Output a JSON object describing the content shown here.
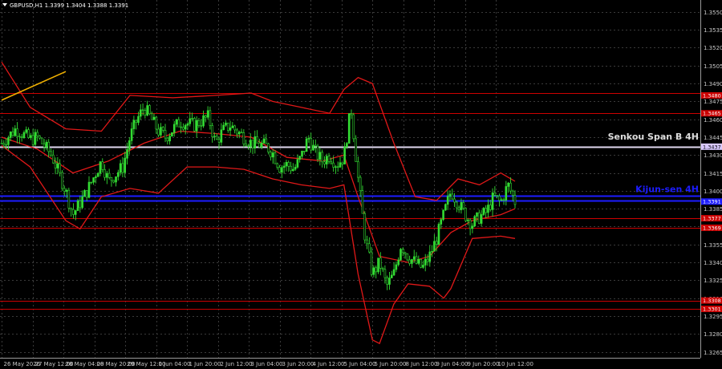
{
  "chart_data": {
    "type": "candlestick",
    "symbol_header": "GBPUSD,H1  1.3399 1.3404 1.3388 1.3391",
    "ylim": [
      1.326,
      1.356
    ],
    "y_ticks": [
      "1.3550",
      "1.3535",
      "1.3520",
      "1.3505",
      "1.3490",
      "1.3475",
      "1.3460",
      "1.3445",
      "1.3430",
      "1.3415",
      "1.3400",
      "1.3385",
      "1.3370",
      "1.3355",
      "1.3340",
      "1.3325",
      "1.3310",
      "1.3295",
      "1.3280",
      "1.3265"
    ],
    "x_labels": [
      "26 May 2026",
      "27 May 12:00",
      "28 May 04:00",
      "28 May 20:00",
      "29 May 12:00",
      "1 Jun 04:00",
      "1 Jun 20:00",
      "2 Jun 12:00",
      "3 Jun 04:00",
      "3 Jun 20:00",
      "4 Jun 12:00",
      "5 Jun 04:00",
      "5 Jun 20:00",
      "8 Jun 12:00",
      "9 Jun 04:00",
      "9 Jun 20:00",
      "10 Jun 12:00"
    ],
    "price_levels": [
      {
        "value": "1.3480",
        "color": "#cc0000"
      },
      {
        "value": "1.3465",
        "color": "#cc0000"
      },
      {
        "value": "1.3437",
        "color": "#d8c8ff"
      },
      {
        "value": "1.3391",
        "color": "#1c1cff"
      },
      {
        "value": "1.3377",
        "color": "#cc0000"
      },
      {
        "value": "1.3369",
        "color": "#cc0000"
      },
      {
        "value": "1.3308",
        "color": "#cc0000"
      },
      {
        "value": "1.3301",
        "color": "#cc0000"
      }
    ],
    "level_lines": [
      1.3482,
      1.3465,
      1.3437,
      1.3396,
      1.3392,
      1.3377,
      1.3369,
      1.3308,
      1.3301
    ],
    "annotations": [
      {
        "text": "Senkou Span B 4H",
        "value": 1.3443,
        "color": "#dcdcdc"
      },
      {
        "text": "Kijun-sen 4H",
        "value": 1.3399,
        "color": "#1c1cff"
      }
    ],
    "close_path": [
      [
        0,
        1.344
      ],
      [
        2,
        1.3452
      ],
      [
        4,
        1.3443
      ],
      [
        5,
        1.3445
      ],
      [
        7,
        1.343
      ],
      [
        9,
        1.34
      ],
      [
        10,
        1.338
      ],
      [
        11,
        1.339
      ],
      [
        12,
        1.34
      ],
      [
        14,
        1.3425
      ],
      [
        15,
        1.3408
      ],
      [
        17,
        1.342
      ],
      [
        18,
        1.3445
      ],
      [
        19,
        1.346
      ],
      [
        20,
        1.347
      ],
      [
        22,
        1.345
      ],
      [
        23,
        1.3445
      ],
      [
        25,
        1.3458
      ],
      [
        27,
        1.3455
      ],
      [
        29,
        1.3462
      ],
      [
        30,
        1.344
      ],
      [
        31,
        1.345
      ],
      [
        32,
        1.3455
      ],
      [
        34,
        1.3445
      ],
      [
        35,
        1.344
      ],
      [
        37,
        1.3438
      ],
      [
        38,
        1.3432
      ],
      [
        39,
        1.342
      ],
      [
        40,
        1.3422
      ],
      [
        41,
        1.3418
      ],
      [
        42,
        1.3428
      ],
      [
        43,
        1.3445
      ],
      [
        44,
        1.3432
      ],
      [
        45,
        1.3425
      ],
      [
        46,
        1.343
      ],
      [
        47,
        1.3422
      ],
      [
        48,
        1.3428
      ],
      [
        49,
        1.347
      ],
      [
        50,
        1.341
      ],
      [
        51,
        1.336
      ],
      [
        52,
        1.333
      ],
      [
        53,
        1.334
      ],
      [
        54,
        1.332
      ],
      [
        55,
        1.333
      ],
      [
        56,
        1.3355
      ],
      [
        57,
        1.3345
      ],
      [
        58,
        1.334
      ],
      [
        59,
        1.3335
      ],
      [
        60,
        1.3345
      ],
      [
        61,
        1.336
      ],
      [
        62,
        1.338
      ],
      [
        63,
        1.34
      ],
      [
        64,
        1.339
      ],
      [
        65,
        1.338
      ],
      [
        66,
        1.3372
      ],
      [
        67,
        1.3378
      ],
      [
        68,
        1.3382
      ],
      [
        69,
        1.3395
      ],
      [
        70,
        1.339
      ],
      [
        71,
        1.3405
      ],
      [
        72,
        1.3391
      ]
    ],
    "indicator_upper": [
      [
        0,
        1.3508
      ],
      [
        4,
        1.347
      ],
      [
        9,
        1.3452
      ],
      [
        14,
        1.345
      ],
      [
        18,
        1.348
      ],
      [
        24,
        1.3478
      ],
      [
        30,
        1.348
      ],
      [
        35,
        1.3482
      ],
      [
        38,
        1.3475
      ],
      [
        42,
        1.347
      ],
      [
        46,
        1.3465
      ],
      [
        48,
        1.3485
      ],
      [
        50,
        1.3495
      ],
      [
        52,
        1.349
      ],
      [
        55,
        1.344
      ],
      [
        58,
        1.3395
      ],
      [
        61,
        1.3392
      ],
      [
        64,
        1.341
      ],
      [
        67,
        1.3405
      ],
      [
        70,
        1.3415
      ],
      [
        72,
        1.3408
      ]
    ],
    "indicator_lower": [
      [
        0,
        1.3438
      ],
      [
        4,
        1.342
      ],
      [
        9,
        1.3375
      ],
      [
        11,
        1.3368
      ],
      [
        14,
        1.3395
      ],
      [
        18,
        1.3402
      ],
      [
        22,
        1.3398
      ],
      [
        26,
        1.342
      ],
      [
        30,
        1.342
      ],
      [
        34,
        1.3418
      ],
      [
        38,
        1.341
      ],
      [
        42,
        1.3405
      ],
      [
        46,
        1.3402
      ],
      [
        48,
        1.3405
      ],
      [
        50,
        1.333
      ],
      [
        52,
        1.3275
      ],
      [
        53,
        1.3272
      ],
      [
        55,
        1.3305
      ],
      [
        57,
        1.3322
      ],
      [
        60,
        1.332
      ],
      [
        62,
        1.331
      ],
      [
        63,
        1.3318
      ],
      [
        66,
        1.336
      ],
      [
        70,
        1.3362
      ],
      [
        72,
        1.336
      ]
    ],
    "indicator_mid": [
      [
        0,
        1.3445
      ],
      [
        5,
        1.3435
      ],
      [
        10,
        1.3415
      ],
      [
        15,
        1.3425
      ],
      [
        20,
        1.344
      ],
      [
        25,
        1.345
      ],
      [
        30,
        1.3448
      ],
      [
        35,
        1.3445
      ],
      [
        40,
        1.3428
      ],
      [
        45,
        1.3425
      ],
      [
        48,
        1.343
      ],
      [
        50,
        1.3395
      ],
      [
        53,
        1.3345
      ],
      [
        57,
        1.334
      ],
      [
        60,
        1.3345
      ],
      [
        63,
        1.3365
      ],
      [
        66,
        1.3375
      ],
      [
        70,
        1.338
      ],
      [
        72,
        1.3385
      ]
    ],
    "trend_segment": [
      [
        0,
        1.3476
      ],
      [
        9,
        1.35
      ]
    ]
  }
}
